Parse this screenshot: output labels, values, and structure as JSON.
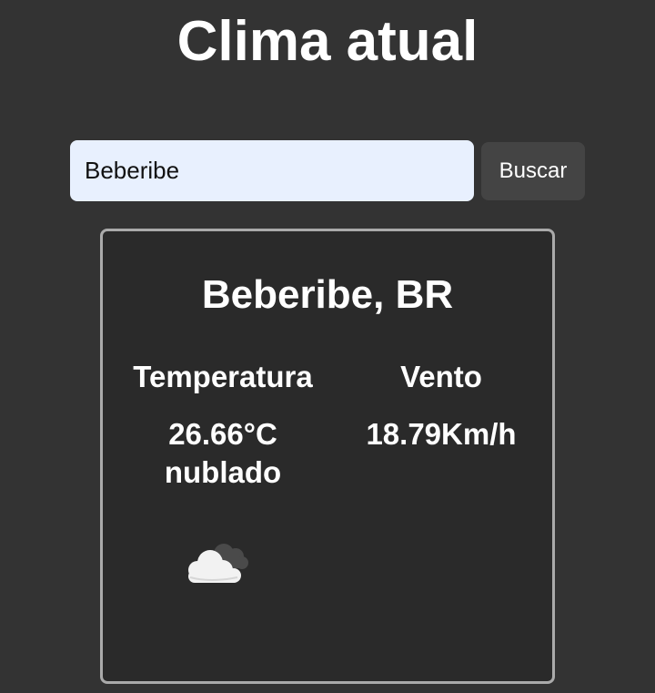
{
  "header": {
    "title": "Clima atual"
  },
  "search": {
    "value": "Beberibe",
    "button_label": "Buscar"
  },
  "weather": {
    "city": "Beberibe, BR",
    "temperature_label": "Temperatura",
    "temperature_value": "26.66°C",
    "condition": "nublado",
    "condition_icon": "cloud-icon",
    "wind_label": "Vento",
    "wind_value": "18.79Km/h"
  },
  "colors": {
    "background": "#333333",
    "card_background": "#2a2a2a",
    "card_border": "#aaaaaa",
    "input_background": "#e8f0fe",
    "button_background": "#444444"
  }
}
